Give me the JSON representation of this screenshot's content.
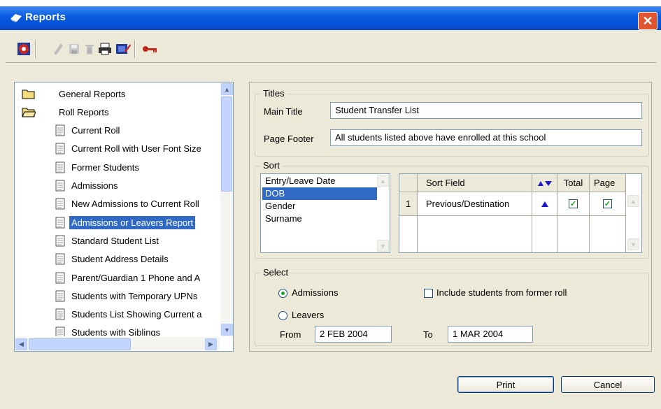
{
  "window": {
    "title": "Reports"
  },
  "toolbar": {
    "icons": [
      "run-report-icon",
      "edit-icon",
      "save-icon",
      "delete-icon",
      "print-icon",
      "tools-icon",
      "key-icon"
    ]
  },
  "tree": {
    "items": [
      {
        "label": "General Reports",
        "icon": "folder-closed-icon"
      },
      {
        "label": "Roll Reports",
        "icon": "folder-open-icon"
      },
      {
        "label": "Current Roll",
        "icon": "report-icon"
      },
      {
        "label": "Current Roll with User Font Size",
        "icon": "report-icon"
      },
      {
        "label": "Former Students",
        "icon": "report-icon"
      },
      {
        "label": "Admissions",
        "icon": "report-icon"
      },
      {
        "label": "New Admissions to Current Roll",
        "icon": "report-icon"
      },
      {
        "label": "Admissions or Leavers Report",
        "icon": "report-icon",
        "selected": true
      },
      {
        "label": "Standard Student List",
        "icon": "report-icon"
      },
      {
        "label": "Student Address Details",
        "icon": "report-icon"
      },
      {
        "label": "Parent/Guardian 1 Phone and A",
        "icon": "report-icon"
      },
      {
        "label": "Students with Temporary UPNs",
        "icon": "report-icon"
      },
      {
        "label": "Students List Showing Current a",
        "icon": "report-icon"
      },
      {
        "label": "Students with Siblings",
        "icon": "report-icon"
      }
    ]
  },
  "titles": {
    "group_label": "Titles",
    "main_title_label": "Main Title",
    "main_title_value": "Student Transfer List",
    "page_footer_label": "Page Footer",
    "page_footer_value": "All students listed above have enrolled at this school"
  },
  "sort": {
    "group_label": "Sort",
    "fields": [
      "Entry/Leave Date",
      "DOB",
      "Gender",
      "Surname"
    ],
    "selected_field": "DOB",
    "grid_headers": {
      "sort_field": "Sort Field",
      "total": "Total",
      "page": "Page"
    },
    "rows": [
      {
        "num": "1",
        "field": "Previous/Destination",
        "total": true,
        "page": true
      }
    ]
  },
  "select": {
    "group_label": "Select",
    "admissions_label": "Admissions",
    "leavers_label": "Leavers",
    "include_former_label": "Include students from former roll",
    "from_label": "From",
    "from_value": "2 FEB 2004",
    "to_label": "To",
    "to_value": "1 MAR 2004",
    "selected_option": "Admissions"
  },
  "buttons": {
    "print": "Print",
    "cancel": "Cancel"
  },
  "colors": {
    "titlebar": "#0a5de0",
    "selection": "#316ac5",
    "face": "#ece9d8"
  }
}
